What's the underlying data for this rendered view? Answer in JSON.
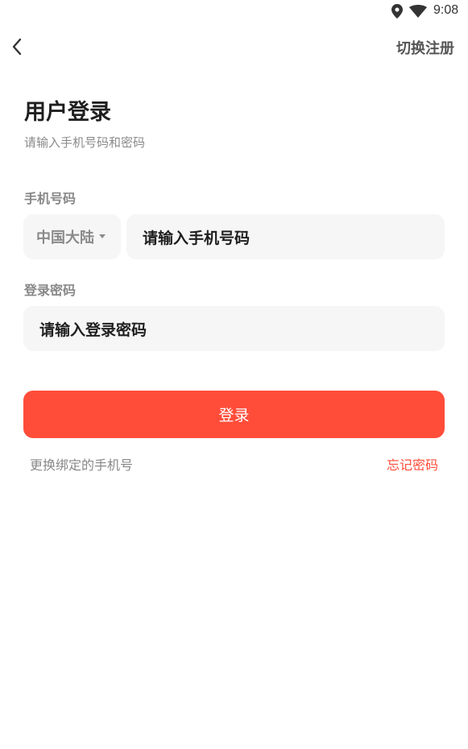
{
  "status_bar": {
    "time": "9:08",
    "icons": [
      "location-icon",
      "wifi-icon"
    ]
  },
  "nav": {
    "back_icon": "chevron-left-icon",
    "switch_register": "切换注册"
  },
  "header": {
    "title": "用户登录",
    "subtitle": "请输入手机号码和密码"
  },
  "form": {
    "phone_label": "手机号码",
    "region_value": "中国大陆",
    "phone_placeholder": "请输入手机号码",
    "password_label": "登录密码",
    "password_placeholder": "请输入登录密码",
    "login_button": "登录"
  },
  "footer_links": {
    "change_phone": "更换绑定的手机号",
    "forgot_password": "忘记密码"
  },
  "colors": {
    "accent": "#ff4d3a",
    "input_bg": "#f6f6f6",
    "muted_text": "#888888"
  }
}
